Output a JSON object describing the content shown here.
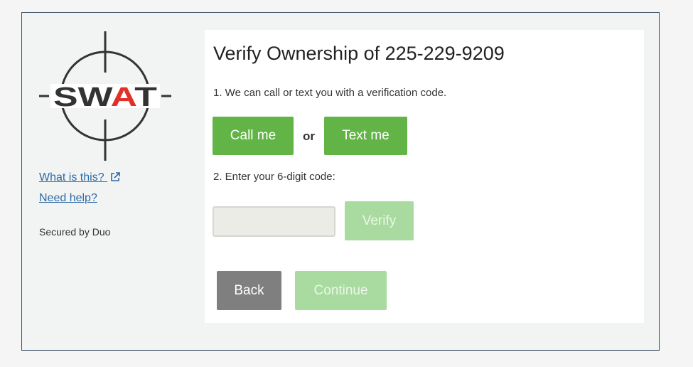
{
  "brand": {
    "logo_text": "SWAT",
    "logo_dark": "#333333",
    "logo_accent": "#e0302a"
  },
  "sidebar": {
    "what_is_this": "What is this?",
    "need_help": "Need help?",
    "secured_by": "Secured by Duo"
  },
  "main": {
    "title": "Verify Ownership of 225-229-9209",
    "step1": "1. We can call or text you with a verification code.",
    "call_label": "Call me",
    "or_text": "or",
    "text_label": "Text me",
    "step2": "2. Enter your 6-digit code:",
    "code_value": "",
    "verify_label": "Verify",
    "back_label": "Back",
    "continue_label": "Continue"
  },
  "colors": {
    "primary_green": "#62b446",
    "disabled_green": "#a9dba0",
    "back_gray": "#7f7f7f",
    "link_blue": "#2d6ba6",
    "frame_border": "#3b5263"
  },
  "icons": {
    "external_link": "external-link-icon",
    "crosshair": "crosshair-icon"
  }
}
